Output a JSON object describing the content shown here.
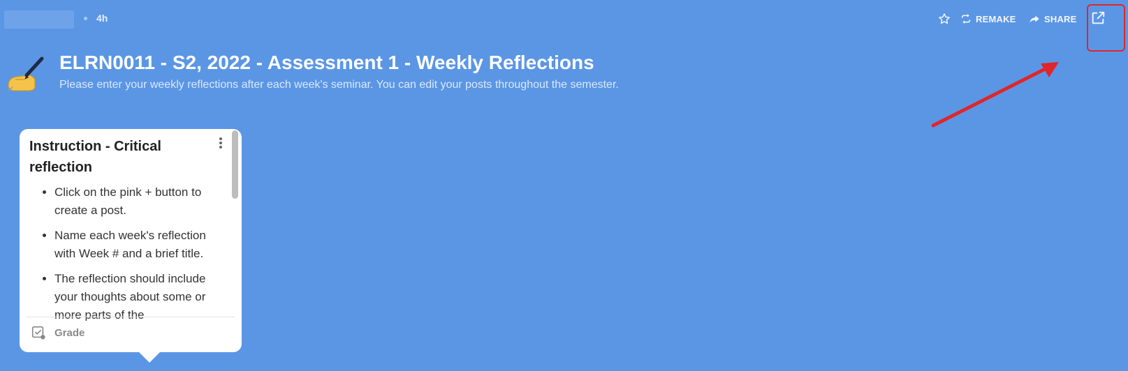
{
  "topbar": {
    "time_ago": "4h",
    "actions": {
      "remake_label": "REMAKE",
      "share_label": "SHARE"
    }
  },
  "header": {
    "title": "ELRN0011 - S2, 2022 - Assessment 1 - Weekly Reflections",
    "subtitle": "Please enter your weekly reflections after each week's seminar. You can edit your posts throughout the semester."
  },
  "card": {
    "title": "Instruction - Critical reflection",
    "items": [
      "Click on the pink + button to create a post.",
      "Name each week's reflection with Week # and a brief title.",
      "The reflection should include your thoughts about some or more parts of the"
    ],
    "grade_label": "Grade"
  },
  "colors": {
    "background": "#5b96e5",
    "highlight": "#e0262a",
    "card": "#ffffff"
  },
  "icons": {
    "star": "star-icon",
    "remake": "repeat-icon",
    "share": "share-arrow-icon",
    "open": "open-in-new-icon",
    "menu": "more-vertical-icon",
    "grade": "grade-check-icon",
    "emoji": "writing-hand-icon"
  }
}
